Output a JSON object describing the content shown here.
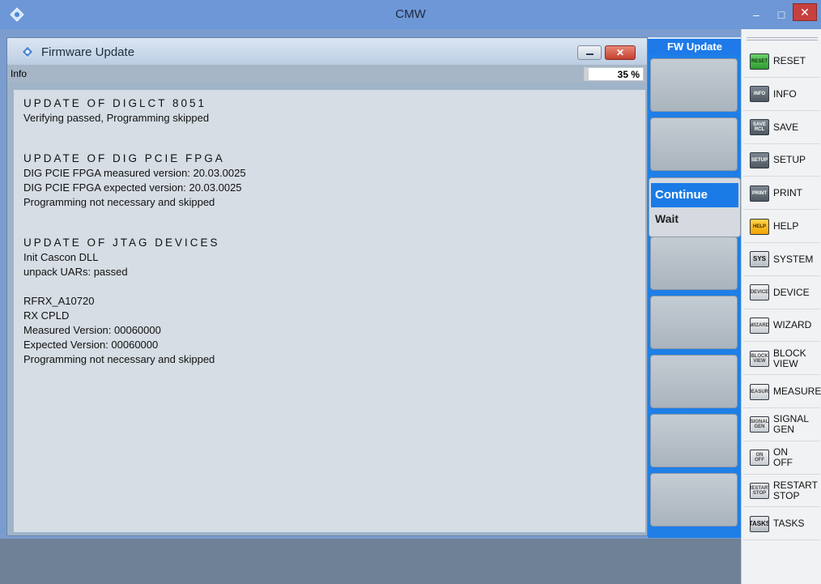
{
  "window": {
    "title": "CMW",
    "controls": {
      "minimize": "–",
      "maximize": "□",
      "close": "✕"
    }
  },
  "dialog": {
    "title": "Firmware Update",
    "close_symbol": "✕",
    "info_label": "Info",
    "progress": {
      "percent": 35,
      "text": "35 %"
    },
    "log": [
      {
        "kind": "head",
        "text": "UPDATE OF DIGLCT 8051"
      },
      {
        "kind": "line",
        "text": "Verifying passed, Programming skipped"
      },
      {
        "kind": "blank"
      },
      {
        "kind": "gap"
      },
      {
        "kind": "head",
        "text": "UPDATE OF DIG PCIE FPGA"
      },
      {
        "kind": "line",
        "text": "DIG PCIE FPGA measured version: 20.03.0025"
      },
      {
        "kind": "line",
        "text": "DIG PCIE FPGA expected version: 20.03.0025"
      },
      {
        "kind": "line",
        "text": "Programming not necessary and skipped"
      },
      {
        "kind": "blank"
      },
      {
        "kind": "gap"
      },
      {
        "kind": "head",
        "text": "UPDATE OF JTAG DEVICES"
      },
      {
        "kind": "line",
        "text": "Init Cascon DLL"
      },
      {
        "kind": "line",
        "text": "unpack UARs: passed"
      },
      {
        "kind": "blank"
      },
      {
        "kind": "line",
        "text": "RFRX_A10720"
      },
      {
        "kind": "line",
        "text": "RX CPLD"
      },
      {
        "kind": "line",
        "text": "Measured Version: 00060000"
      },
      {
        "kind": "line",
        "text": "Expected Version: 00060000"
      },
      {
        "kind": "line",
        "text": "Programming not necessary and skipped"
      }
    ]
  },
  "softkeys": {
    "header": "FW Update",
    "options": {
      "selected": "Continue",
      "other": "Wait"
    }
  },
  "hardkeys": [
    {
      "icon": "RESET",
      "label": "RESET",
      "style": "green"
    },
    {
      "icon": "INFO",
      "label": "INFO",
      "style": ""
    },
    {
      "icon": "SAVE RCL",
      "label": "SAVE",
      "style": ""
    },
    {
      "icon": "SETUP",
      "label": "SETUP",
      "style": ""
    },
    {
      "icon": "PRINT",
      "label": "PRINT",
      "style": ""
    },
    {
      "icon": "HELP",
      "label": "HELP",
      "style": "yellow"
    },
    {
      "icon": "SYS",
      "label": "SYSTEM",
      "style": "sys"
    },
    {
      "icon": "DEVICE",
      "label": "DEVICE",
      "style": "light"
    },
    {
      "icon": "WIZARD",
      "label": "WIZARD",
      "style": "light"
    },
    {
      "icon": "BLOCK VIEW",
      "label": "BLOCK\nVIEW",
      "style": "light"
    },
    {
      "icon": "MEASURE",
      "label": "MEASURE",
      "style": "light"
    },
    {
      "icon": "SIGNAL GEN",
      "label": "SIGNAL\nGEN",
      "style": "light"
    },
    {
      "icon": "ON OFF",
      "label": "ON\nOFF",
      "style": "light"
    },
    {
      "icon": "RESTART STOP",
      "label": "RESTART\nSTOP",
      "style": "light"
    },
    {
      "icon": "TASKS",
      "label": "TASKS",
      "style": "sys"
    }
  ]
}
